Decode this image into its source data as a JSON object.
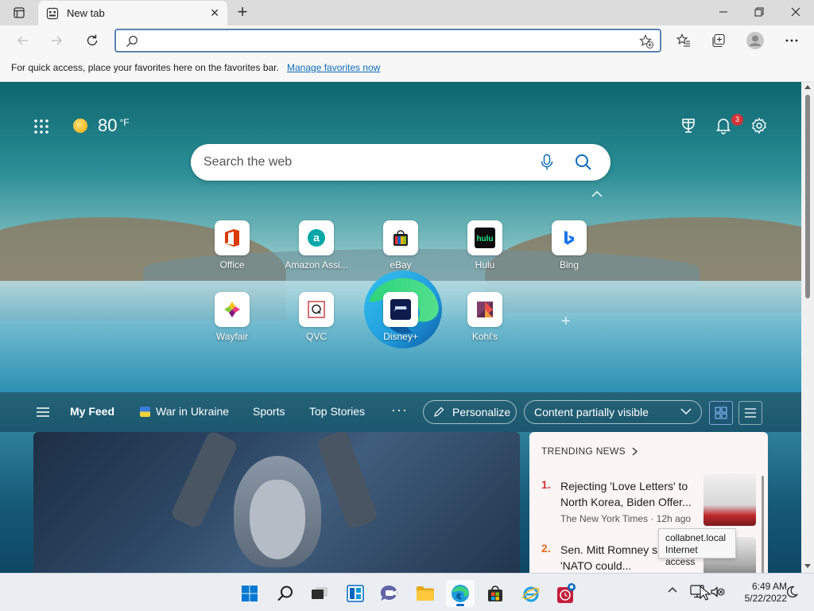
{
  "tab": {
    "title": "New tab",
    "close": "✕"
  },
  "window": {
    "new_tab": "+"
  },
  "toolbar": {
    "address_value": "",
    "address_placeholder": ""
  },
  "favbar": {
    "message": "For quick access, place your favorites here on the favorites bar.",
    "link": "Manage favorites now"
  },
  "weather": {
    "temp": "80",
    "unit": "°F"
  },
  "notifications": {
    "count": "3"
  },
  "search": {
    "placeholder": "Search the web"
  },
  "quick_links": [
    {
      "label": "Office",
      "icon": "office-icon"
    },
    {
      "label": "Amazon Assi...",
      "icon": "amazon-icon"
    },
    {
      "label": "eBay",
      "icon": "ebay-icon"
    },
    {
      "label": "Hulu",
      "icon": "hulu-icon"
    },
    {
      "label": "Bing",
      "icon": "bing-icon"
    },
    {
      "label": "Wayfair",
      "icon": "wayfair-icon"
    },
    {
      "label": "QVC",
      "icon": "qvc-icon"
    },
    {
      "label": "Disney+",
      "icon": "disney-icon"
    },
    {
      "label": "Kohl's",
      "icon": "kohls-icon"
    }
  ],
  "add_site": "+",
  "feed": {
    "nav": [
      "My Feed",
      "War in Ukraine",
      "Sports",
      "Top Stories",
      "···"
    ],
    "personalize": "Personalize",
    "visibility": "Content partially visible"
  },
  "trending": {
    "title": "TRENDING NEWS",
    "items": [
      {
        "num": "1.",
        "headline": "Rejecting 'Love Letters' to North Korea, Biden Offer...",
        "source": "The New York Times · 12h ago"
      },
      {
        "num": "2.",
        "headline": "Sen. Mitt Romney suggests 'NATO could...",
        "source": ""
      }
    ]
  },
  "tooltip": {
    "line1": "collabnet.local",
    "line2": "Internet access"
  },
  "taskbar": {
    "time": "6:49 AM",
    "date": "5/22/2022"
  },
  "colors": {
    "accent": "#0067c0",
    "link": "#0f6cbd",
    "badge": "#d13438",
    "address_border": "#5b83b0"
  }
}
